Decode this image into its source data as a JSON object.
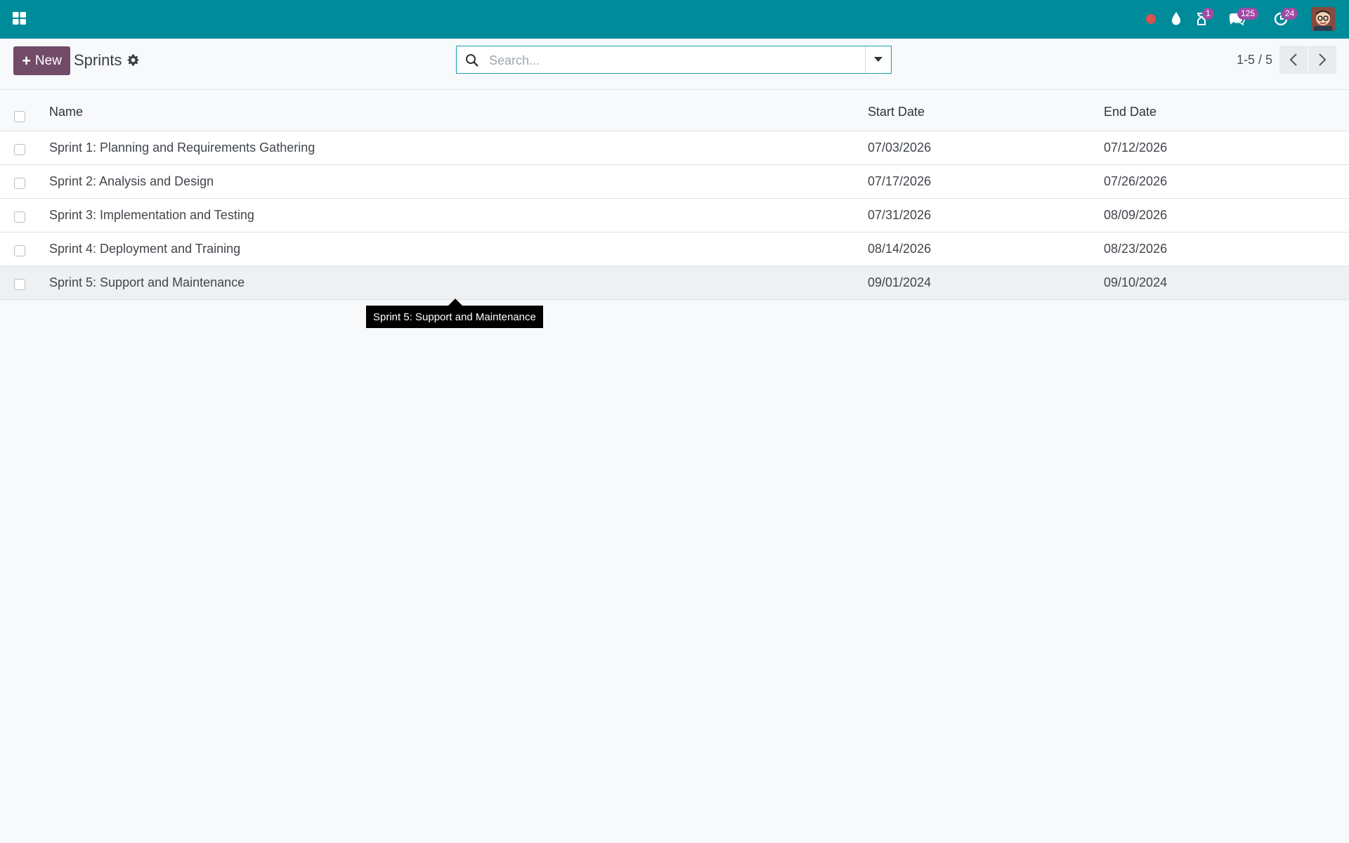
{
  "navbar": {
    "background": "#008b9b",
    "apps_icon": "grid-icon",
    "icons": [
      {
        "name": "status-dot-icon",
        "color": "#d9534f",
        "badge": ""
      },
      {
        "name": "drop-icon",
        "badge": ""
      },
      {
        "name": "hourglass-icon",
        "badge": "1"
      },
      {
        "name": "chat-icon",
        "badge": "125"
      },
      {
        "name": "clock-activity-icon",
        "badge": "24"
      }
    ],
    "badge_color": "#a04ba6"
  },
  "control_panel": {
    "new_button_label": "New",
    "new_button_color": "#714b67",
    "title": "Sprints",
    "search_placeholder": "Search...",
    "pager_value": "1-5 / 5"
  },
  "table": {
    "columns": [
      "Name",
      "Start Date",
      "End Date"
    ],
    "rows": [
      {
        "name": "Sprint 1: Planning and Requirements Gathering",
        "start": "07/03/2026",
        "end": "07/12/2026"
      },
      {
        "name": "Sprint 2: Analysis and Design",
        "start": "07/17/2026",
        "end": "07/26/2026"
      },
      {
        "name": "Sprint 3: Implementation and Testing",
        "start": "07/31/2026",
        "end": "08/09/2026"
      },
      {
        "name": "Sprint 4: Deployment and Training",
        "start": "08/14/2026",
        "end": "08/23/2026"
      },
      {
        "name": "Sprint 5: Support and Maintenance",
        "start": "09/01/2024",
        "end": "09/10/2024"
      }
    ]
  },
  "tooltip": {
    "text": "Sprint 5: Support and Maintenance"
  }
}
